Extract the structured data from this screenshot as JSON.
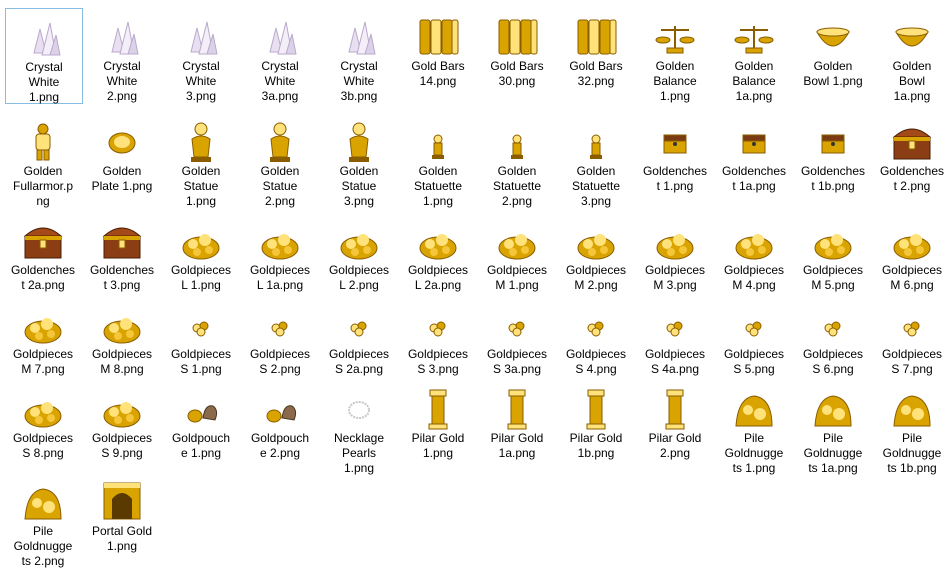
{
  "window": {
    "view": "Large icons",
    "selected_index": 0
  },
  "files": [
    {
      "label": "Crystal\nWhite\n1.png",
      "icon": "crystal-white-icon"
    },
    {
      "label": "Crystal\nWhite\n2.png",
      "icon": "crystal-white-icon"
    },
    {
      "label": "Crystal\nWhite\n3.png",
      "icon": "crystal-white-icon"
    },
    {
      "label": "Crystal\nWhite\n3a.png",
      "icon": "crystal-white-icon"
    },
    {
      "label": "Crystal\nWhite\n3b.png",
      "icon": "crystal-white-icon"
    },
    {
      "label": "Gold Bars\n14.png",
      "icon": "gold-bars-icon"
    },
    {
      "label": "Gold Bars\n30.png",
      "icon": "gold-bars-icon"
    },
    {
      "label": "Gold Bars\n32.png",
      "icon": "gold-bars-icon"
    },
    {
      "label": "Golden\nBalance\n1.png",
      "icon": "golden-balance-icon"
    },
    {
      "label": "Golden\nBalance\n1a.png",
      "icon": "golden-balance-icon"
    },
    {
      "label": "Golden\nBowl 1.png",
      "icon": "golden-bowl-icon"
    },
    {
      "label": "Golden\nBowl\n1a.png",
      "icon": "golden-bowl-icon"
    },
    {
      "label": "Golden\nFullarmor.p\nng",
      "icon": "golden-armor-icon"
    },
    {
      "label": "Golden\nPlate 1.png",
      "icon": "golden-plate-icon"
    },
    {
      "label": "Golden\nStatue\n1.png",
      "icon": "golden-statue-icon"
    },
    {
      "label": "Golden\nStatue\n2.png",
      "icon": "golden-statue-icon"
    },
    {
      "label": "Golden\nStatue\n3.png",
      "icon": "golden-statue-icon"
    },
    {
      "label": "Golden\nStatuette\n1.png",
      "icon": "golden-statuette-icon"
    },
    {
      "label": "Golden\nStatuette\n2.png",
      "icon": "golden-statuette-icon"
    },
    {
      "label": "Golden\nStatuette\n3.png",
      "icon": "golden-statuette-icon"
    },
    {
      "label": "Goldenches\nt 1.png",
      "icon": "gold-chest-icon"
    },
    {
      "label": "Goldenches\nt 1a.png",
      "icon": "gold-chest-icon"
    },
    {
      "label": "Goldenches\nt 1b.png",
      "icon": "gold-chest-icon"
    },
    {
      "label": "Goldenches\nt 2.png",
      "icon": "treasure-chest-icon"
    },
    {
      "label": "Goldenches\nt 2a.png",
      "icon": "treasure-chest-icon"
    },
    {
      "label": "Goldenches\nt 3.png",
      "icon": "treasure-chest-icon"
    },
    {
      "label": "Goldpieces\nL 1.png",
      "icon": "gold-pile-icon"
    },
    {
      "label": "Goldpieces\nL 1a.png",
      "icon": "gold-pile-icon"
    },
    {
      "label": "Goldpieces\nL 2.png",
      "icon": "gold-pile-icon"
    },
    {
      "label": "Goldpieces\nL 2a.png",
      "icon": "gold-pile-icon"
    },
    {
      "label": "Goldpieces\nM 1.png",
      "icon": "gold-pile-icon"
    },
    {
      "label": "Goldpieces\nM 2.png",
      "icon": "gold-pile-icon"
    },
    {
      "label": "Goldpieces\nM 3.png",
      "icon": "gold-pile-icon"
    },
    {
      "label": "Goldpieces\nM 4.png",
      "icon": "gold-pile-icon"
    },
    {
      "label": "Goldpieces\nM 5.png",
      "icon": "gold-pile-icon"
    },
    {
      "label": "Goldpieces\nM 6.png",
      "icon": "gold-pile-icon"
    },
    {
      "label": "Goldpieces\nM 7.png",
      "icon": "gold-pile-icon"
    },
    {
      "label": "Goldpieces\nM 8.png",
      "icon": "gold-pile-icon"
    },
    {
      "label": "Goldpieces\nS 1.png",
      "icon": "gold-coins-small-icon"
    },
    {
      "label": "Goldpieces\nS 2.png",
      "icon": "gold-coins-small-icon"
    },
    {
      "label": "Goldpieces\nS 2a.png",
      "icon": "gold-coins-small-icon"
    },
    {
      "label": "Goldpieces\nS 3.png",
      "icon": "gold-coins-small-icon"
    },
    {
      "label": "Goldpieces\nS 3a.png",
      "icon": "gold-coins-small-icon"
    },
    {
      "label": "Goldpieces\nS 4.png",
      "icon": "gold-coins-small-icon"
    },
    {
      "label": "Goldpieces\nS 4a.png",
      "icon": "gold-coins-small-icon"
    },
    {
      "label": "Goldpieces\nS 5.png",
      "icon": "gold-coins-small-icon"
    },
    {
      "label": "Goldpieces\nS 6.png",
      "icon": "gold-coins-small-icon"
    },
    {
      "label": "Goldpieces\nS 7.png",
      "icon": "gold-coins-small-icon"
    },
    {
      "label": "Goldpieces\nS 8.png",
      "icon": "gold-pile-icon"
    },
    {
      "label": "Goldpieces\nS 9.png",
      "icon": "gold-pile-icon"
    },
    {
      "label": "Goldpouch\ne 1.png",
      "icon": "gold-pouch-icon"
    },
    {
      "label": "Goldpouch\ne 2.png",
      "icon": "gold-pouch-icon"
    },
    {
      "label": "Necklage\nPearls\n1.png",
      "icon": "pearl-necklace-icon"
    },
    {
      "label": "Pilar Gold\n1.png",
      "icon": "gold-pillar-icon"
    },
    {
      "label": "Pilar Gold\n1a.png",
      "icon": "gold-pillar-icon"
    },
    {
      "label": "Pilar Gold\n1b.png",
      "icon": "gold-pillar-icon"
    },
    {
      "label": "Pilar Gold\n2.png",
      "icon": "gold-pillar-icon"
    },
    {
      "label": "Pile\nGoldnugge\nts 1.png",
      "icon": "gold-nuggets-icon"
    },
    {
      "label": "Pile\nGoldnugge\nts 1a.png",
      "icon": "gold-nuggets-icon"
    },
    {
      "label": "Pile\nGoldnugge\nts 1b.png",
      "icon": "gold-nuggets-icon"
    },
    {
      "label": "Pile\nGoldnugge\nts 2.png",
      "icon": "gold-nuggets-icon"
    },
    {
      "label": "Portal Gold\n1.png",
      "icon": "gold-portal-icon"
    }
  ]
}
